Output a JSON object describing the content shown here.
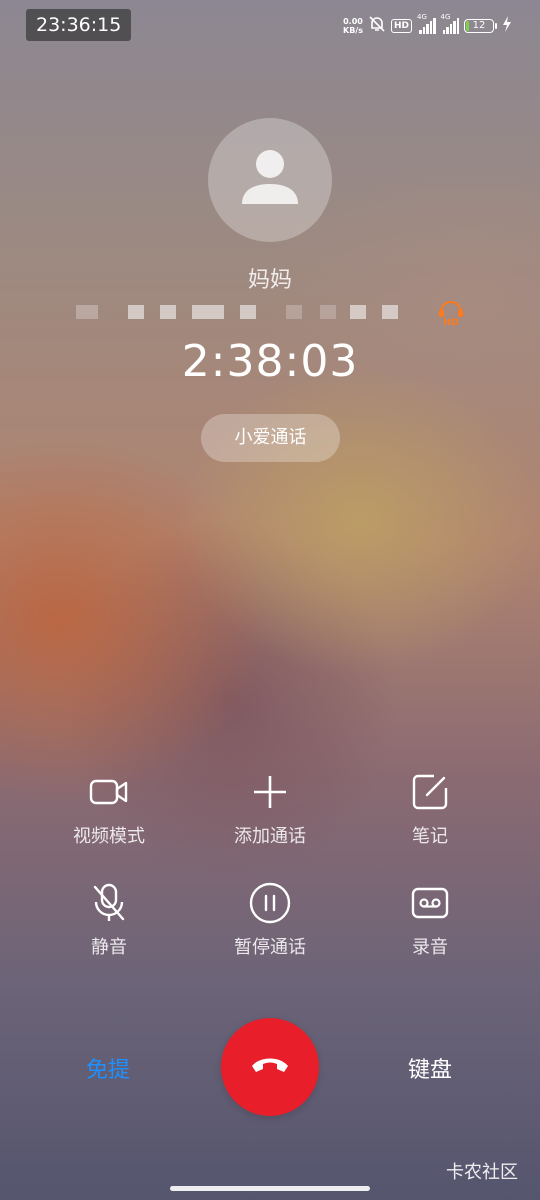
{
  "status_bar": {
    "time": "23:36:15",
    "net_speed_value": "0.00",
    "net_speed_unit": "KB/s",
    "hd_label": "HD",
    "sim1_label": "4G",
    "sim2_label": "4G",
    "battery_level": "12",
    "battery_fill": 0.12,
    "icons": [
      "net-speed",
      "mute-bell-icon",
      "volte-hd-icon",
      "signal-icon",
      "signal-icon",
      "battery-icon",
      "charging-bolt-icon"
    ]
  },
  "call": {
    "contact_name": "妈妈",
    "duration": "2:38:03",
    "xiaoai_chip_label": "小爱通话",
    "hd_badge": "HD"
  },
  "controls": [
    {
      "id": "video",
      "label": "视频模式",
      "icon": "video-camera-icon"
    },
    {
      "id": "add",
      "label": "添加通话",
      "icon": "plus-icon"
    },
    {
      "id": "notes",
      "label": "笔记",
      "icon": "note-edit-icon"
    },
    {
      "id": "mute",
      "label": "静音",
      "icon": "mic-off-icon"
    },
    {
      "id": "hold",
      "label": "暂停通话",
      "icon": "pause-circle-icon"
    },
    {
      "id": "record",
      "label": "录音",
      "icon": "record-tape-icon"
    }
  ],
  "bottom": {
    "speaker_label": "免提",
    "keypad_label": "键盘",
    "end_call_icon": "phone-hangup-icon"
  },
  "colors": {
    "end_call": "#e81e2a",
    "speaker_active": "#1e90ff",
    "hd_accent": "#ff7a1a",
    "battery_fill": "#7bd34a"
  },
  "watermark": "卡农社区"
}
